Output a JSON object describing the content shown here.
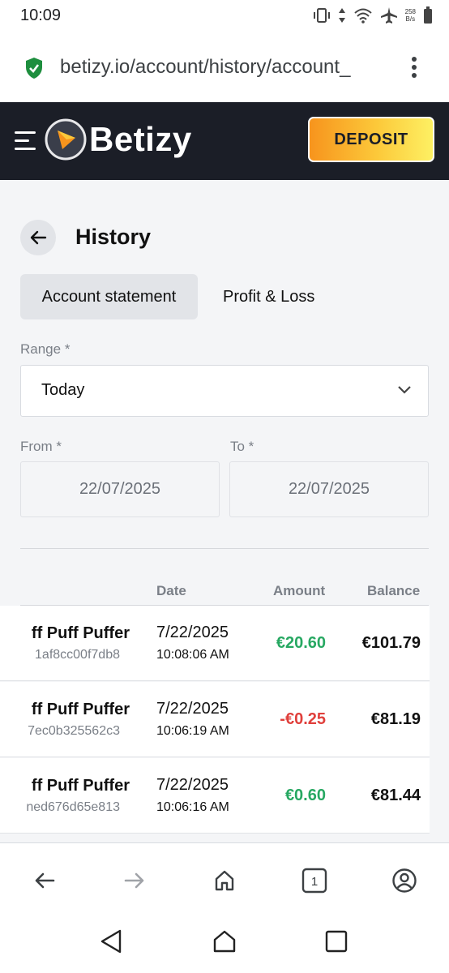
{
  "status_bar": {
    "time": "10:09",
    "net_speed_value": "258",
    "net_speed_unit": "B/s"
  },
  "browser": {
    "url": "betizy.io/account/history/account_",
    "tab_count": "1"
  },
  "site_header": {
    "logo_text": "Betizy",
    "deposit_label": "DEPOSIT"
  },
  "page": {
    "title": "History"
  },
  "tabs": [
    {
      "label": "Account statement",
      "active": true
    },
    {
      "label": "Profit & Loss",
      "active": false
    }
  ],
  "filters": {
    "range_label": "Range *",
    "range_value": "Today",
    "from_label": "From *",
    "from_value": "22/07/2025",
    "to_label": "To *",
    "to_value": "22/07/2025"
  },
  "table": {
    "columns": [
      "Date",
      "Amount",
      "Balance"
    ],
    "rows": [
      {
        "name": "ff Puff Puffer",
        "hash": "1af8cc00f7db8",
        "date": "7/22/2025",
        "time": "10:08:06 AM",
        "amount": "€20.60",
        "amount_sign": "positive",
        "balance": "€101.79"
      },
      {
        "name": "ff Puff Puffer",
        "hash": "7ec0b325562c3",
        "date": "7/22/2025",
        "time": "10:06:19 AM",
        "amount": "-€0.25",
        "amount_sign": "negative",
        "balance": "€81.19"
      },
      {
        "name": "ff Puff Puffer",
        "hash": "ned676d65e813",
        "date": "7/22/2025",
        "time": "10:06:16 AM",
        "amount": "€0.60",
        "amount_sign": "positive",
        "balance": "€81.44"
      }
    ]
  },
  "colors": {
    "header_bg": "#1b1e27",
    "positive": "#27a862",
    "negative": "#e0403c",
    "deposit_gradient_start": "#f7941d",
    "deposit_gradient_end": "#fdf063"
  }
}
